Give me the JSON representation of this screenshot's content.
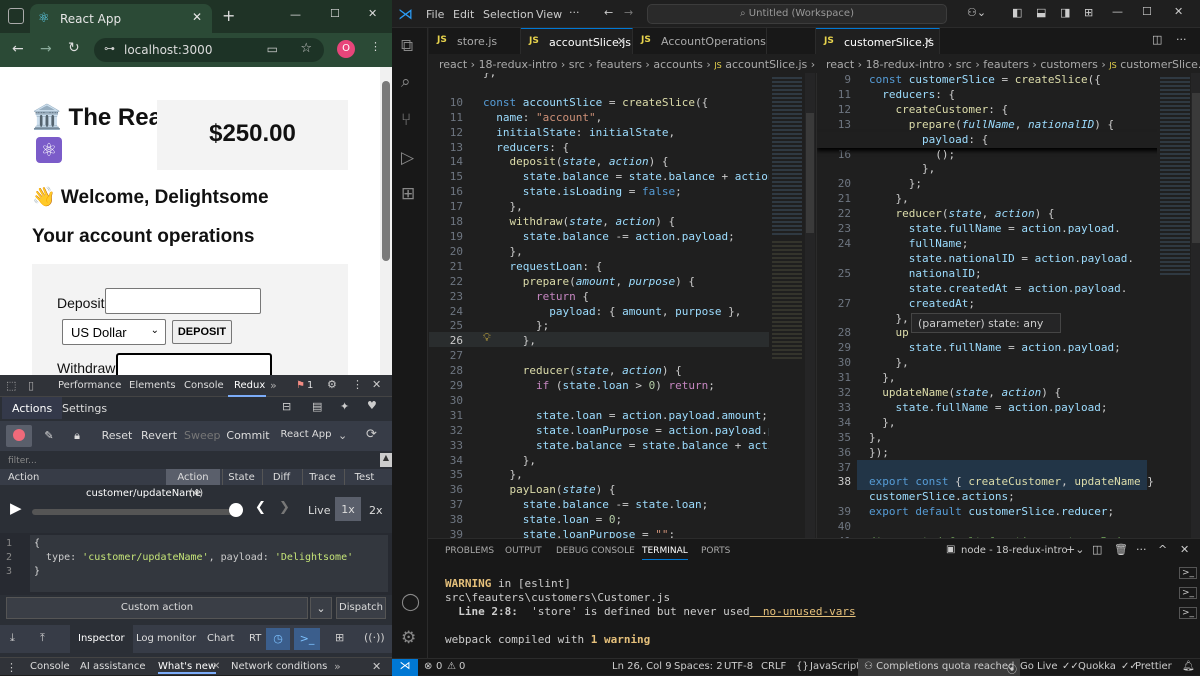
{
  "chrome": {
    "tab_title": "React App",
    "url": "localhost:3000",
    "profile_initial": "O"
  },
  "app": {
    "title": "🏛️ The Rea",
    "balance": "$250.00",
    "welcome": "👋 Welcome, Delightsome",
    "operations_heading": "Your account operations",
    "deposit_label": "Deposit",
    "deposit_value": "",
    "currency_selected": "US Dollar",
    "deposit_button": "DEPOSIT",
    "withdraw_label": "Withdraw",
    "withdraw_value": ""
  },
  "devtools": {
    "tabs": [
      "Performance",
      "Elements",
      "Console",
      "Redux"
    ],
    "issues_count": "1",
    "subtabs": [
      "Actions",
      "Settings"
    ],
    "buttons": [
      "Reset",
      "Revert",
      "Sweep",
      "Commit"
    ],
    "instance": "React App",
    "filter_placeholder": "filter...",
    "monitor_tabs": [
      "Action",
      "State",
      "Diff",
      "Trace",
      "Test"
    ],
    "list_item": "Action",
    "slider_label": "customer/updateName",
    "slider_count": "(4)",
    "speed_live": "Live",
    "speed_1x": "1x",
    "speed_2x": "2x",
    "dispatch_lines": [
      "{",
      "  type: 'customer/updateName', payload: 'Delightsome'",
      "}"
    ],
    "custom_action": "Custom action",
    "dispatch_button": "Dispatch",
    "bottom_tabs": [
      "Inspector",
      "Log monitor",
      "Chart",
      "RT"
    ],
    "drawer_tabs": [
      "Console",
      "AI assistance",
      "What's new",
      "Network conditions"
    ]
  },
  "vscode": {
    "menu": [
      "File",
      "Edit",
      "Selection",
      "View"
    ],
    "search": "Untitled (Workspace)",
    "left_tabs": [
      "store.js",
      "accountSlice.js",
      "AccountOperations.js"
    ],
    "right_tabs": [
      "customerSlice.js"
    ],
    "left_breadcrumb": [
      "react",
      "18-redux-intro",
      "src",
      "feauters",
      "accounts",
      "accountSlice.js",
      "ac"
    ],
    "right_breadcrumb": [
      "react",
      "18-redux-intro",
      "src",
      "feauters",
      "customers",
      "customerSlice.js"
    ],
    "hover_tooltip": "(parameter) state: any",
    "panel_tabs": [
      "PROBLEMS",
      "OUTPUT",
      "DEBUG CONSOLE",
      "TERMINAL",
      "PORTS"
    ],
    "terminal_name": "node - 18-redux-intro",
    "terminal_lines": [
      {
        "a": "WARNING",
        "b": " in [eslint]",
        "c": "",
        "d": ""
      },
      {
        "a": "",
        "b": "src\\feauters\\customers\\Customer.js",
        "c": "",
        "d": ""
      },
      {
        "a": "",
        "b": "  Line 2:8:  ",
        "c": "'store' is defined but never used",
        "d": "  no-unused-vars"
      },
      {
        "a": "",
        "b": "",
        "c": "",
        "d": ""
      },
      {
        "a": "",
        "b": "webpack compiled with ",
        "c": "1 warning",
        "d": ""
      }
    ],
    "status": {
      "errors": "0",
      "warnings": "0",
      "ports": "0",
      "position": "Ln 26, Col 9",
      "spaces": "Spaces: 2",
      "encoding": "UTF-8",
      "eol": "CRLF",
      "language": "JavaScript",
      "copilot": "Completions quota reached",
      "golive": "Go Live",
      "quokka": "Quokka",
      "prettier": "Prettier"
    }
  },
  "colors": {
    "accent": "#0078d4",
    "chrome_green": "#2b4a36",
    "redux_accent": "#3b8beb"
  }
}
